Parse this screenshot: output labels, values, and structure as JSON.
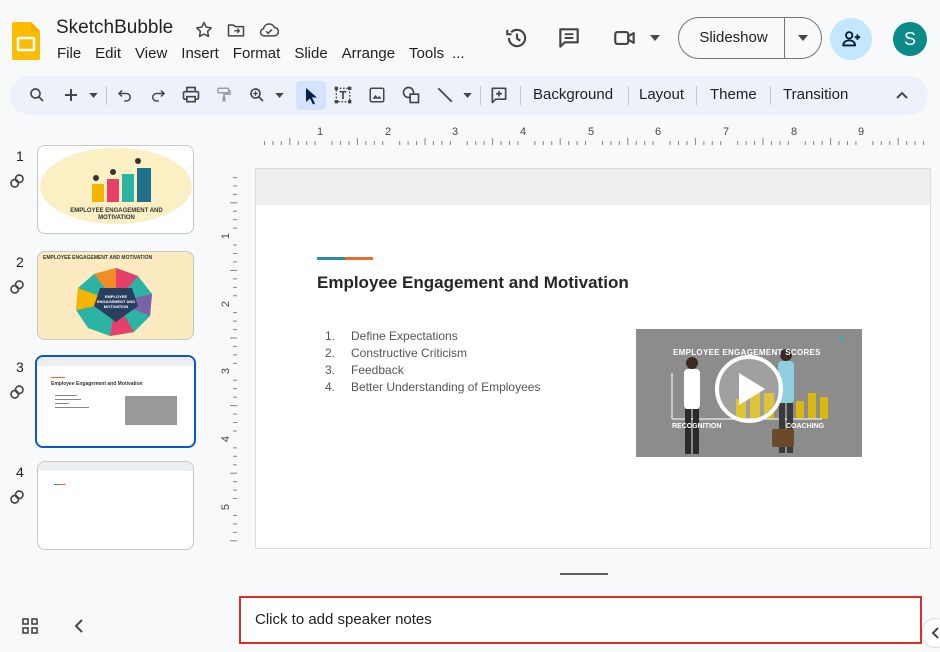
{
  "app": {
    "title": "SketchBubble",
    "avatar_initial": "S"
  },
  "menu": [
    "File",
    "Edit",
    "View",
    "Insert",
    "Format",
    "Slide",
    "Arrange",
    "Tools",
    "..."
  ],
  "header": {
    "slideshow_label": "Slideshow"
  },
  "toolbar": {
    "background_label": "Background",
    "layout_label": "Layout",
    "theme_label": "Theme",
    "transition_label": "Transition"
  },
  "ruler": {
    "horizontal": [
      "1",
      "2",
      "3",
      "4",
      "5",
      "6",
      "7",
      "8",
      "9"
    ],
    "vertical": [
      "1",
      "2",
      "3",
      "4",
      "5"
    ]
  },
  "filmstrip": {
    "slides": [
      {
        "number": "1",
        "caption": "EMPLOYEE ENGAGEMENT AND MOTIVATION"
      },
      {
        "number": "2",
        "caption": "EMPLOYEE ENGAGEMENT AND MOTIVATION",
        "center": "EMPLOYEE ENGAGEMENT AND MOTIVATION"
      },
      {
        "number": "3",
        "caption": "Employee Engagement and Motivation"
      },
      {
        "number": "4",
        "caption": ""
      }
    ],
    "active_index": 3
  },
  "slide": {
    "title": "Employee Engagement and Motivation",
    "items": [
      {
        "num": "1.",
        "text": "Define Expectations"
      },
      {
        "num": "2.",
        "text": "Constructive Criticism"
      },
      {
        "num": "3.",
        "text": "Feedback"
      },
      {
        "num": "4.",
        "text": "Better Understanding of Employees"
      }
    ],
    "video_overlay_text": "EMPLOYEE ENGAGEMENT SCORES",
    "video_bottom_labels": [
      "RECOGNITION",
      "COACHING"
    ]
  },
  "notes": {
    "placeholder": "Click to add speaker notes"
  },
  "colors": {
    "accent_blue": "#0b57d0",
    "notes_border": "#d93025",
    "avatar": "#0b8a8a",
    "share_bg": "#c2e7ff"
  }
}
